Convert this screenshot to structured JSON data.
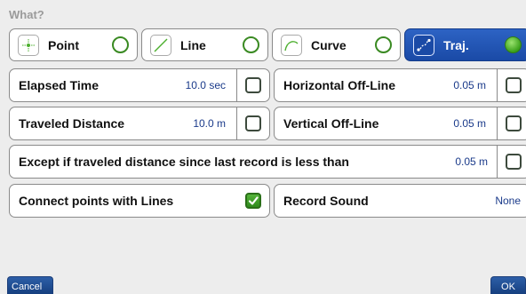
{
  "header": {
    "title": "What?"
  },
  "type_selector": {
    "items": [
      {
        "label": "Point"
      },
      {
        "label": "Line"
      },
      {
        "label": "Curve"
      },
      {
        "label": "Traj."
      }
    ]
  },
  "options": {
    "elapsed_time": {
      "label": "Elapsed Time",
      "value": "10.0 sec",
      "checked": false
    },
    "horizontal_offline": {
      "label": "Horizontal Off-Line",
      "value": "0.05 m",
      "checked": false
    },
    "traveled_distance": {
      "label": "Traveled Distance",
      "value": "10.0 m",
      "checked": false
    },
    "vertical_offline": {
      "label": "Vertical Off-Line",
      "value": "0.05 m",
      "checked": false
    },
    "except": {
      "label": "Except if traveled distance since last record is less than",
      "value": "0.05 m",
      "checked": false
    },
    "connect_points": {
      "label": "Connect points with Lines",
      "checked": true
    },
    "record_sound": {
      "label": "Record Sound",
      "value": "None"
    }
  },
  "footer": {
    "cancel_label": "Cancel",
    "ok_label": "OK"
  },
  "colors": {
    "accent": "#1a4aa6",
    "check_green": "#3aa01a",
    "value_text": "#1a3a8a"
  }
}
